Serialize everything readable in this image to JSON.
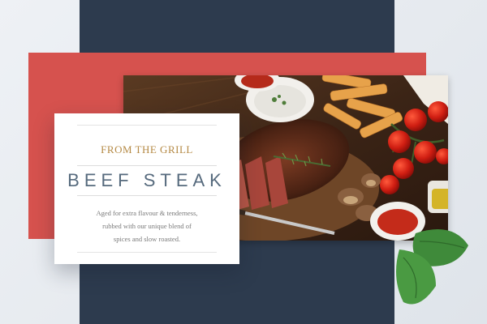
{
  "card": {
    "eyebrow": "FROM THE GRILL",
    "title": "BEEF STEAK",
    "description_lines": [
      "Aged for extra flavour & tenderness,",
      "rubbed with our unique blend of",
      "spices and slow roasted."
    ]
  },
  "colors": {
    "navy": "#2d3b4e",
    "red": "#d6524e",
    "gold": "#b58a45",
    "title": "#566a7d",
    "background": "#eef1f5"
  },
  "icons": {
    "photo": "grilled-steak-photo",
    "leaf": "basil-leaf-decoration"
  }
}
